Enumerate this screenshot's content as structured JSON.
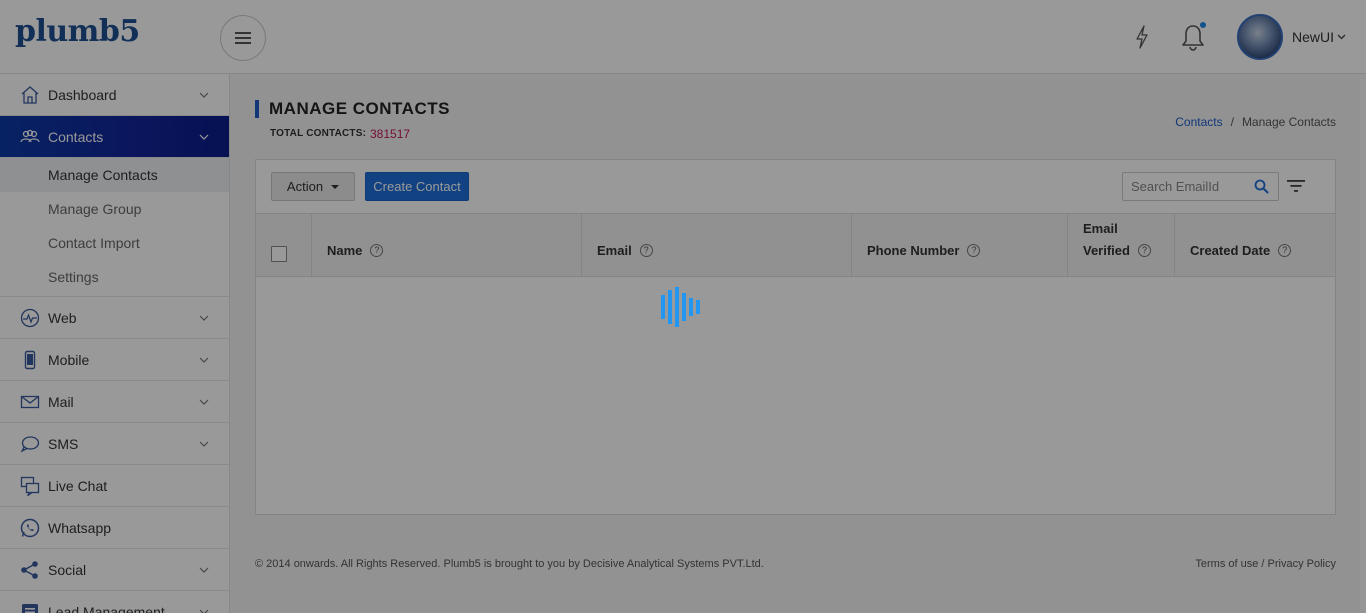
{
  "header": {
    "logo": "plumb5",
    "user_name": "NewUI",
    "menu_icon": "hamburger-icon",
    "bolt_icon": "lightning-icon",
    "bell_icon": "bell-icon"
  },
  "sidebar": {
    "items": [
      {
        "label": "Dashboard",
        "icon": "home-icon"
      },
      {
        "label": "Contacts",
        "icon": "contacts-icon",
        "active": true,
        "children": [
          "Manage Contacts",
          "Manage Group",
          "Contact Import",
          "Settings"
        ]
      },
      {
        "label": "Web",
        "icon": "web-icon"
      },
      {
        "label": "Mobile",
        "icon": "mobile-icon"
      },
      {
        "label": "Mail",
        "icon": "mail-icon"
      },
      {
        "label": "SMS",
        "icon": "sms-icon"
      },
      {
        "label": "Live Chat",
        "icon": "livechat-icon"
      },
      {
        "label": "Whatsapp",
        "icon": "whatsapp-icon"
      },
      {
        "label": "Social",
        "icon": "share-icon"
      },
      {
        "label": "Lead Management",
        "icon": "lead-icon"
      }
    ]
  },
  "page": {
    "title": "MANAGE CONTACTS",
    "total_label": "TOTAL CONTACTS:",
    "total_value": "381517",
    "breadcrumb": {
      "parent": "Contacts",
      "separator": "/",
      "current": "Manage Contacts"
    }
  },
  "toolbar": {
    "action_label": "Action",
    "create_label": "Create Contact",
    "search_placeholder": "Search EmailId"
  },
  "table": {
    "columns": [
      {
        "label": "Name"
      },
      {
        "label": "Email"
      },
      {
        "label": "Phone Number"
      },
      {
        "label_line1": "Email",
        "label_line2": "Verified"
      },
      {
        "label": "Created Date"
      }
    ],
    "help_glyph": "?"
  },
  "footer": {
    "copyright": "© 2014 onwards. All Rights Reserved. Plumb5 is brought to you by Decisive Analytical Systems PVT.Ltd.",
    "terms": "Terms of use",
    "separator": "/",
    "privacy": "Privacy Policy"
  },
  "colors": {
    "brand": "#1d4f91",
    "accent": "#1e6fd9",
    "active_nav": "#0c3aa6",
    "total_value": "#c2185b",
    "loader": "#2196f3"
  }
}
